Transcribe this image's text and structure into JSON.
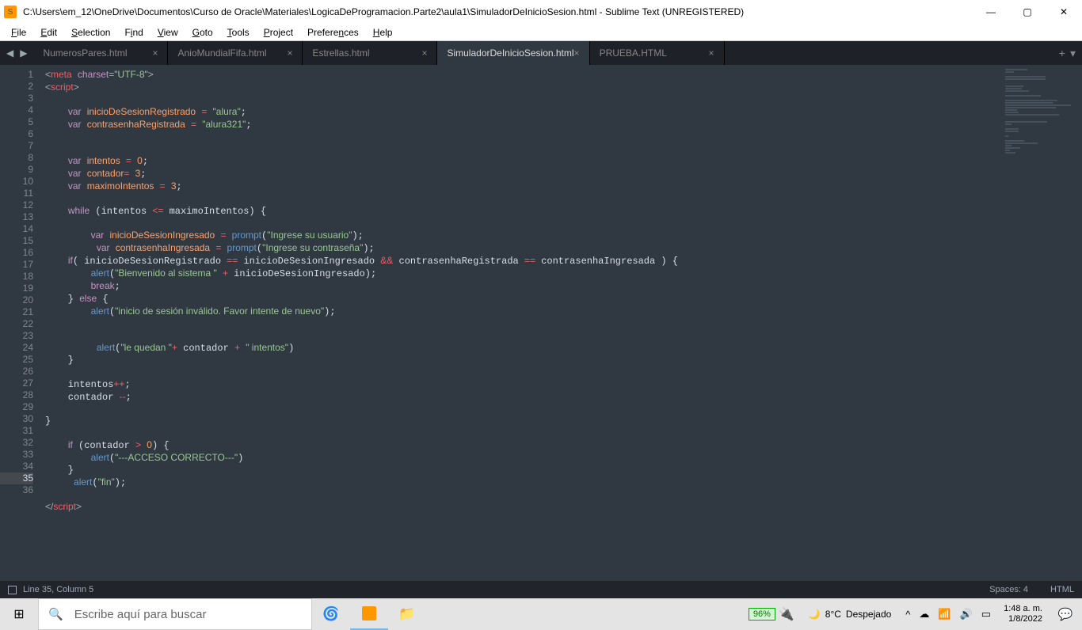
{
  "window": {
    "title": "C:\\Users\\em_12\\OneDrive\\Documentos\\Curso de Oracle\\Materiales\\LogicaDeProgramacion.Parte2\\aula1\\SimuladorDeInicioSesion.html - Sublime Text (UNREGISTERED)"
  },
  "menus": [
    "File",
    "Edit",
    "Selection",
    "Find",
    "View",
    "Goto",
    "Tools",
    "Project",
    "Preferences",
    "Help"
  ],
  "tabs": [
    {
      "label": "NumerosPares.html",
      "active": false
    },
    {
      "label": "AnioMundialFifa.html",
      "active": false
    },
    {
      "label": "Estrellas.html",
      "active": false
    },
    {
      "label": "SimuladorDeInicioSesion.html",
      "active": true
    },
    {
      "label": "PRUEBA.HTML",
      "active": false
    }
  ],
  "code_lines_count": 36,
  "current_line": 35,
  "status": {
    "position": "Line 35, Column 5",
    "spaces": "Spaces: 4",
    "lang": "HTML"
  },
  "taskbar": {
    "search_placeholder": "Escribe aquí para buscar",
    "battery": "96%",
    "weather_temp": "8°C",
    "weather_desc": "Despejado",
    "time": "1:48 a. m.",
    "date": "1/8/2022"
  }
}
